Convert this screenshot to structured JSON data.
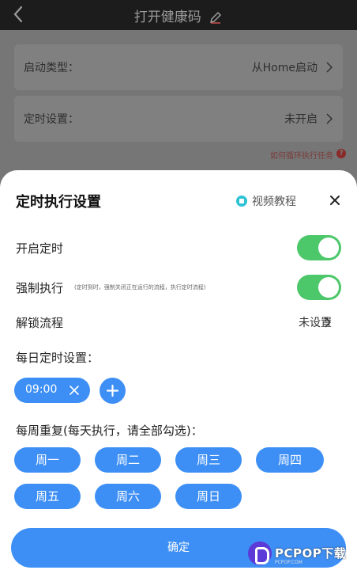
{
  "header": {
    "title": "打开健康码"
  },
  "background": {
    "start_type": {
      "label": "启动类型：",
      "value": "从Home启动"
    },
    "timer_setting": {
      "label": "定时设置：",
      "value": "未开启"
    },
    "help_link": "如何循环执行任务"
  },
  "sheet": {
    "title": "定时执行设置",
    "video_tutorial": "视频教程",
    "enable_timer": {
      "label": "开启定时",
      "on": true
    },
    "force_run": {
      "label": "强制执行",
      "note": "(定时到时，强制关闭正在运行的流程，执行定时流程)",
      "on": true
    },
    "unlock_flow": {
      "label": "解锁流程",
      "value": "未设置"
    },
    "daily_label": "每日定时设置：",
    "times": [
      "09:00"
    ],
    "weekly_label": "每周重复(每天执行，请全部勾选)：",
    "days": [
      "周一",
      "周二",
      "周三",
      "周四",
      "周五",
      "周六",
      "周日"
    ],
    "confirm": "确定"
  },
  "watermark": {
    "text": "PCPOP下载",
    "sub": "PCPOP.COM"
  },
  "colors": {
    "accent": "#3d8ff5",
    "toggle_on": "#4cc76a"
  }
}
